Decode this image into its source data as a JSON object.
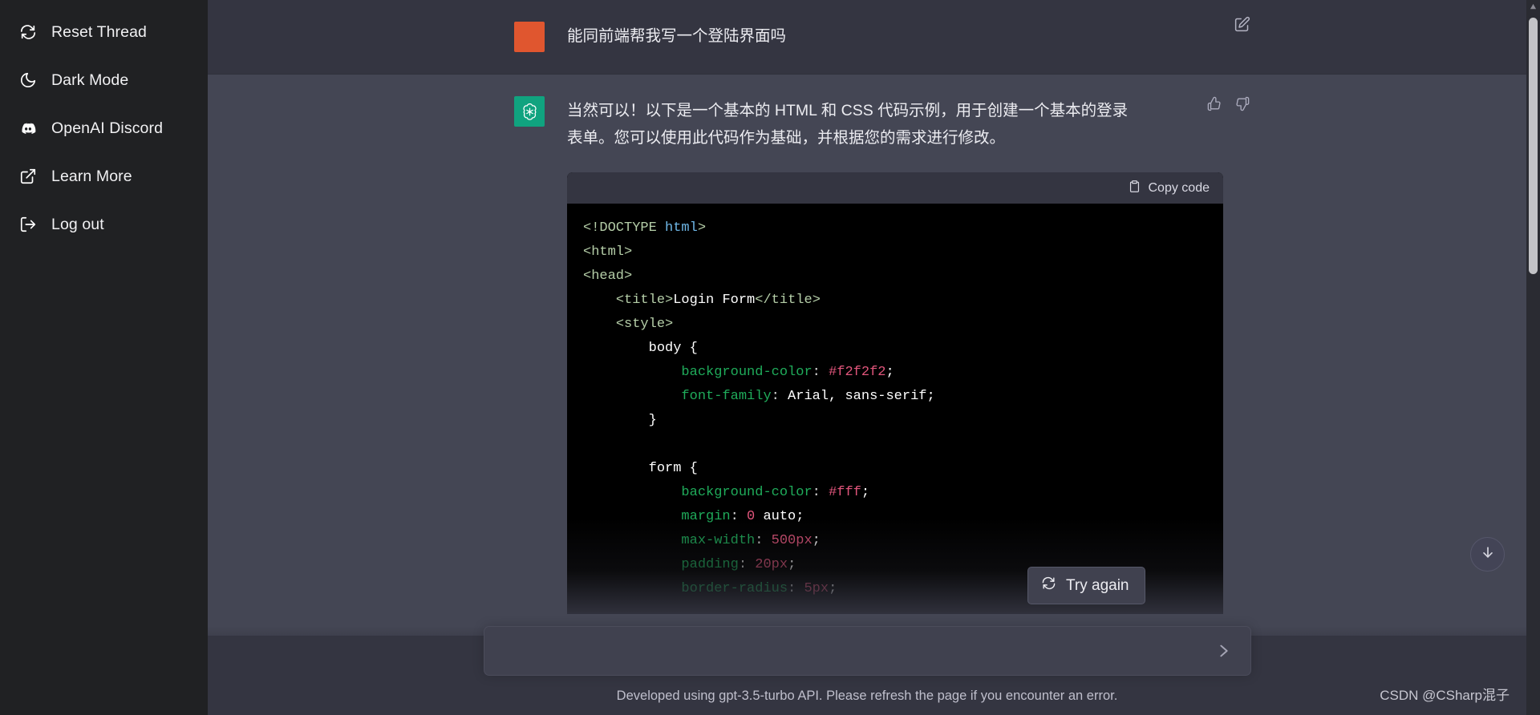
{
  "sidebar": {
    "items": [
      {
        "label": "Reset Thread",
        "icon": "reset-icon"
      },
      {
        "label": "Dark Mode",
        "icon": "moon-icon"
      },
      {
        "label": "OpenAI Discord",
        "icon": "discord-icon"
      },
      {
        "label": "Learn More",
        "icon": "external-link-icon"
      },
      {
        "label": "Log out",
        "icon": "logout-icon"
      }
    ]
  },
  "conversation": {
    "user_message": {
      "text": "能同前端帮我写一个登陆界面吗",
      "avatar_color": "#e0562f"
    },
    "assistant_message": {
      "text": "当然可以！以下是一个基本的 HTML 和 CSS 代码示例，用于创建一个基本的登录表单。您可以使用此代码作为基础，并根据您的需求进行修改。",
      "avatar_color": "#10a37f"
    },
    "code_block": {
      "copy_label": "Copy code",
      "language": "html",
      "lines": [
        "<!DOCTYPE html>",
        "<html>",
        "<head>",
        "    <title>Login Form</title>",
        "    <style>",
        "        body {",
        "            background-color: #f2f2f2;",
        "            font-family: Arial, sans-serif;",
        "        }",
        "",
        "        form {",
        "            background-color: #fff;",
        "            margin: 0 auto;",
        "            max-width: 500px;",
        "            padding: 20px;",
        "            border-radius: 5px;"
      ]
    }
  },
  "actions": {
    "edit_label": "edit-message",
    "thumbs_up_label": "thumbs-up",
    "thumbs_down_label": "thumbs-down",
    "try_again_label": "Try again",
    "scroll_to_bottom_label": "scroll-to-bottom"
  },
  "composer": {
    "value": "",
    "placeholder": "",
    "send_label": "send"
  },
  "footer": {
    "note": "Developed using gpt-3.5-turbo API. Please refresh the page if you encounter an error."
  },
  "watermark": {
    "text": "CSDN @CSharp混子"
  },
  "colors": {
    "sidebar_bg": "#202123",
    "user_row_bg": "#343541",
    "assistant_row_bg": "#444654",
    "code_bg": "#000000",
    "accent_green": "#10a37f",
    "accent_orange": "#e0562f"
  }
}
